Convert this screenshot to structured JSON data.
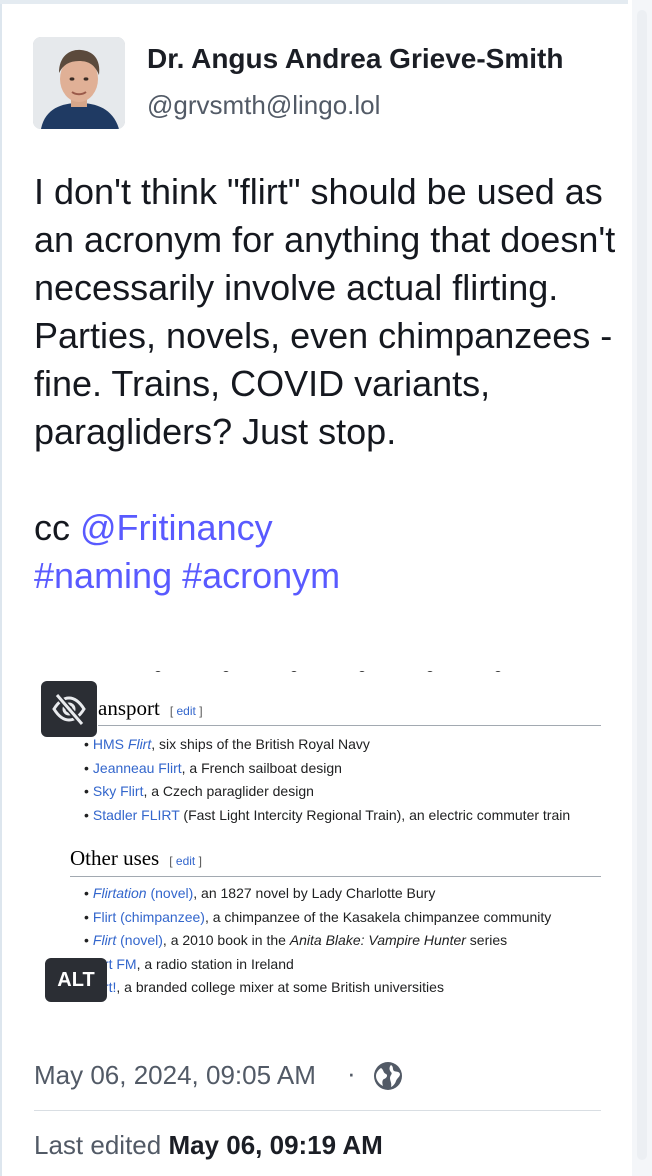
{
  "author": {
    "display_name": "Dr. Angus Andrea Grieve-Smith",
    "handle": "@grvsmth@lingo.lol"
  },
  "post": {
    "paragraph1": "I don't think \"flirt\" should be used as an acronym for anything that doesn't necessarily involve actual flirting.  Parties, novels, even chimpanzees - fine.  Trains, COVID variants, paragliders? Just stop.",
    "cc_prefix": "cc ",
    "mention": "@Fritinancy",
    "hashtag1": "#naming",
    "hashtag2": "#acronym"
  },
  "media": {
    "alt_badge": "ALT",
    "hide_icon": "eye-slash-icon",
    "wiki": {
      "section1_heading": "ansport",
      "section2_heading": "Other uses",
      "edit_label": "edit",
      "transport": [
        {
          "link": "HMS ",
          "link_italic": "Flirt",
          "rest": ", six ships of the British Royal Navy"
        },
        {
          "link": "Jeanneau Flirt",
          "rest": ", a French sailboat design"
        },
        {
          "link": "Sky Flirt",
          "rest": ", a Czech paraglider design"
        },
        {
          "link": "Stadler FLIRT",
          "rest": " (Fast Light Intercity Regional Train), an electric commuter train"
        }
      ],
      "other_uses": [
        {
          "link_italic": "Flirtation",
          "link": " (novel)",
          "rest": ", an 1827 novel by Lady Charlotte Bury"
        },
        {
          "link": "Flirt (chimpanzee)",
          "rest": ", a chimpanzee of the Kasakela chimpanzee community"
        },
        {
          "link_italic": "Flirt",
          "link": " (novel)",
          "rest_prefix": ", a 2010 book in the ",
          "rest_italic": "Anita Blake: Vampire Hunter",
          "rest": " series"
        },
        {
          "link": "rt FM",
          "rest": ", a radio station in Ireland"
        },
        {
          "link": "rt!",
          "rest": ", a branded college mixer at some British universities"
        }
      ]
    }
  },
  "meta": {
    "timestamp": "May 06, 2024, 09:05 AM",
    "separator": "·",
    "visibility_icon": "globe-icon",
    "edited_prefix": "Last edited ",
    "edited_time": "May 06, 09:19 AM"
  },
  "colors": {
    "link": "#595aff",
    "wiki_link": "#3366cc",
    "muted": "#525a66"
  }
}
